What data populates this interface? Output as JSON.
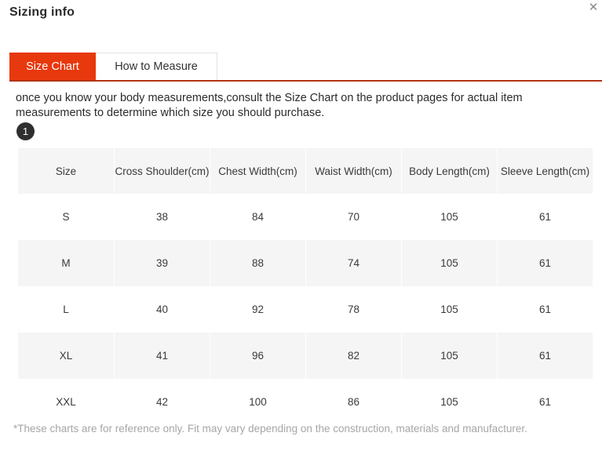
{
  "modal": {
    "title": "Sizing info",
    "close_icon": "close-icon",
    "close_glyph": "✕"
  },
  "tabs": [
    {
      "label": "Size Chart",
      "active": true
    },
    {
      "label": "How to Measure",
      "active": false
    }
  ],
  "intro": {
    "text": "once you know your body measurements,consult the Size Chart on the product pages for actual item measurements to determine which size you should purchase."
  },
  "step_badge": {
    "number": "1"
  },
  "table": {
    "headers": [
      "Size",
      "Cross Shoulder(cm)",
      "Chest Width(cm)",
      "Waist Width(cm)",
      "Body Length(cm)",
      "Sleeve Length(cm)"
    ],
    "rows": [
      {
        "size": "S",
        "cross_shoulder": "38",
        "chest_width": "84",
        "waist_width": "70",
        "body_length": "105",
        "sleeve_length": "61"
      },
      {
        "size": "M",
        "cross_shoulder": "39",
        "chest_width": "88",
        "waist_width": "74",
        "body_length": "105",
        "sleeve_length": "61"
      },
      {
        "size": "L",
        "cross_shoulder": "40",
        "chest_width": "92",
        "waist_width": "78",
        "body_length": "105",
        "sleeve_length": "61"
      },
      {
        "size": "XL",
        "cross_shoulder": "41",
        "chest_width": "96",
        "waist_width": "82",
        "body_length": "105",
        "sleeve_length": "61"
      },
      {
        "size": "XXL",
        "cross_shoulder": "42",
        "chest_width": "100",
        "waist_width": "86",
        "body_length": "105",
        "sleeve_length": "61"
      }
    ]
  },
  "footnote": {
    "text": "*These charts are for reference only. Fit may vary depending on the construction, materials and manufacturer."
  },
  "colors": {
    "accent": "#e8380d",
    "accent_underline": "#b33214",
    "stripe": "#f5f5f5",
    "badge": "#2f2f2f",
    "muted_text": "#a6a6a6"
  }
}
